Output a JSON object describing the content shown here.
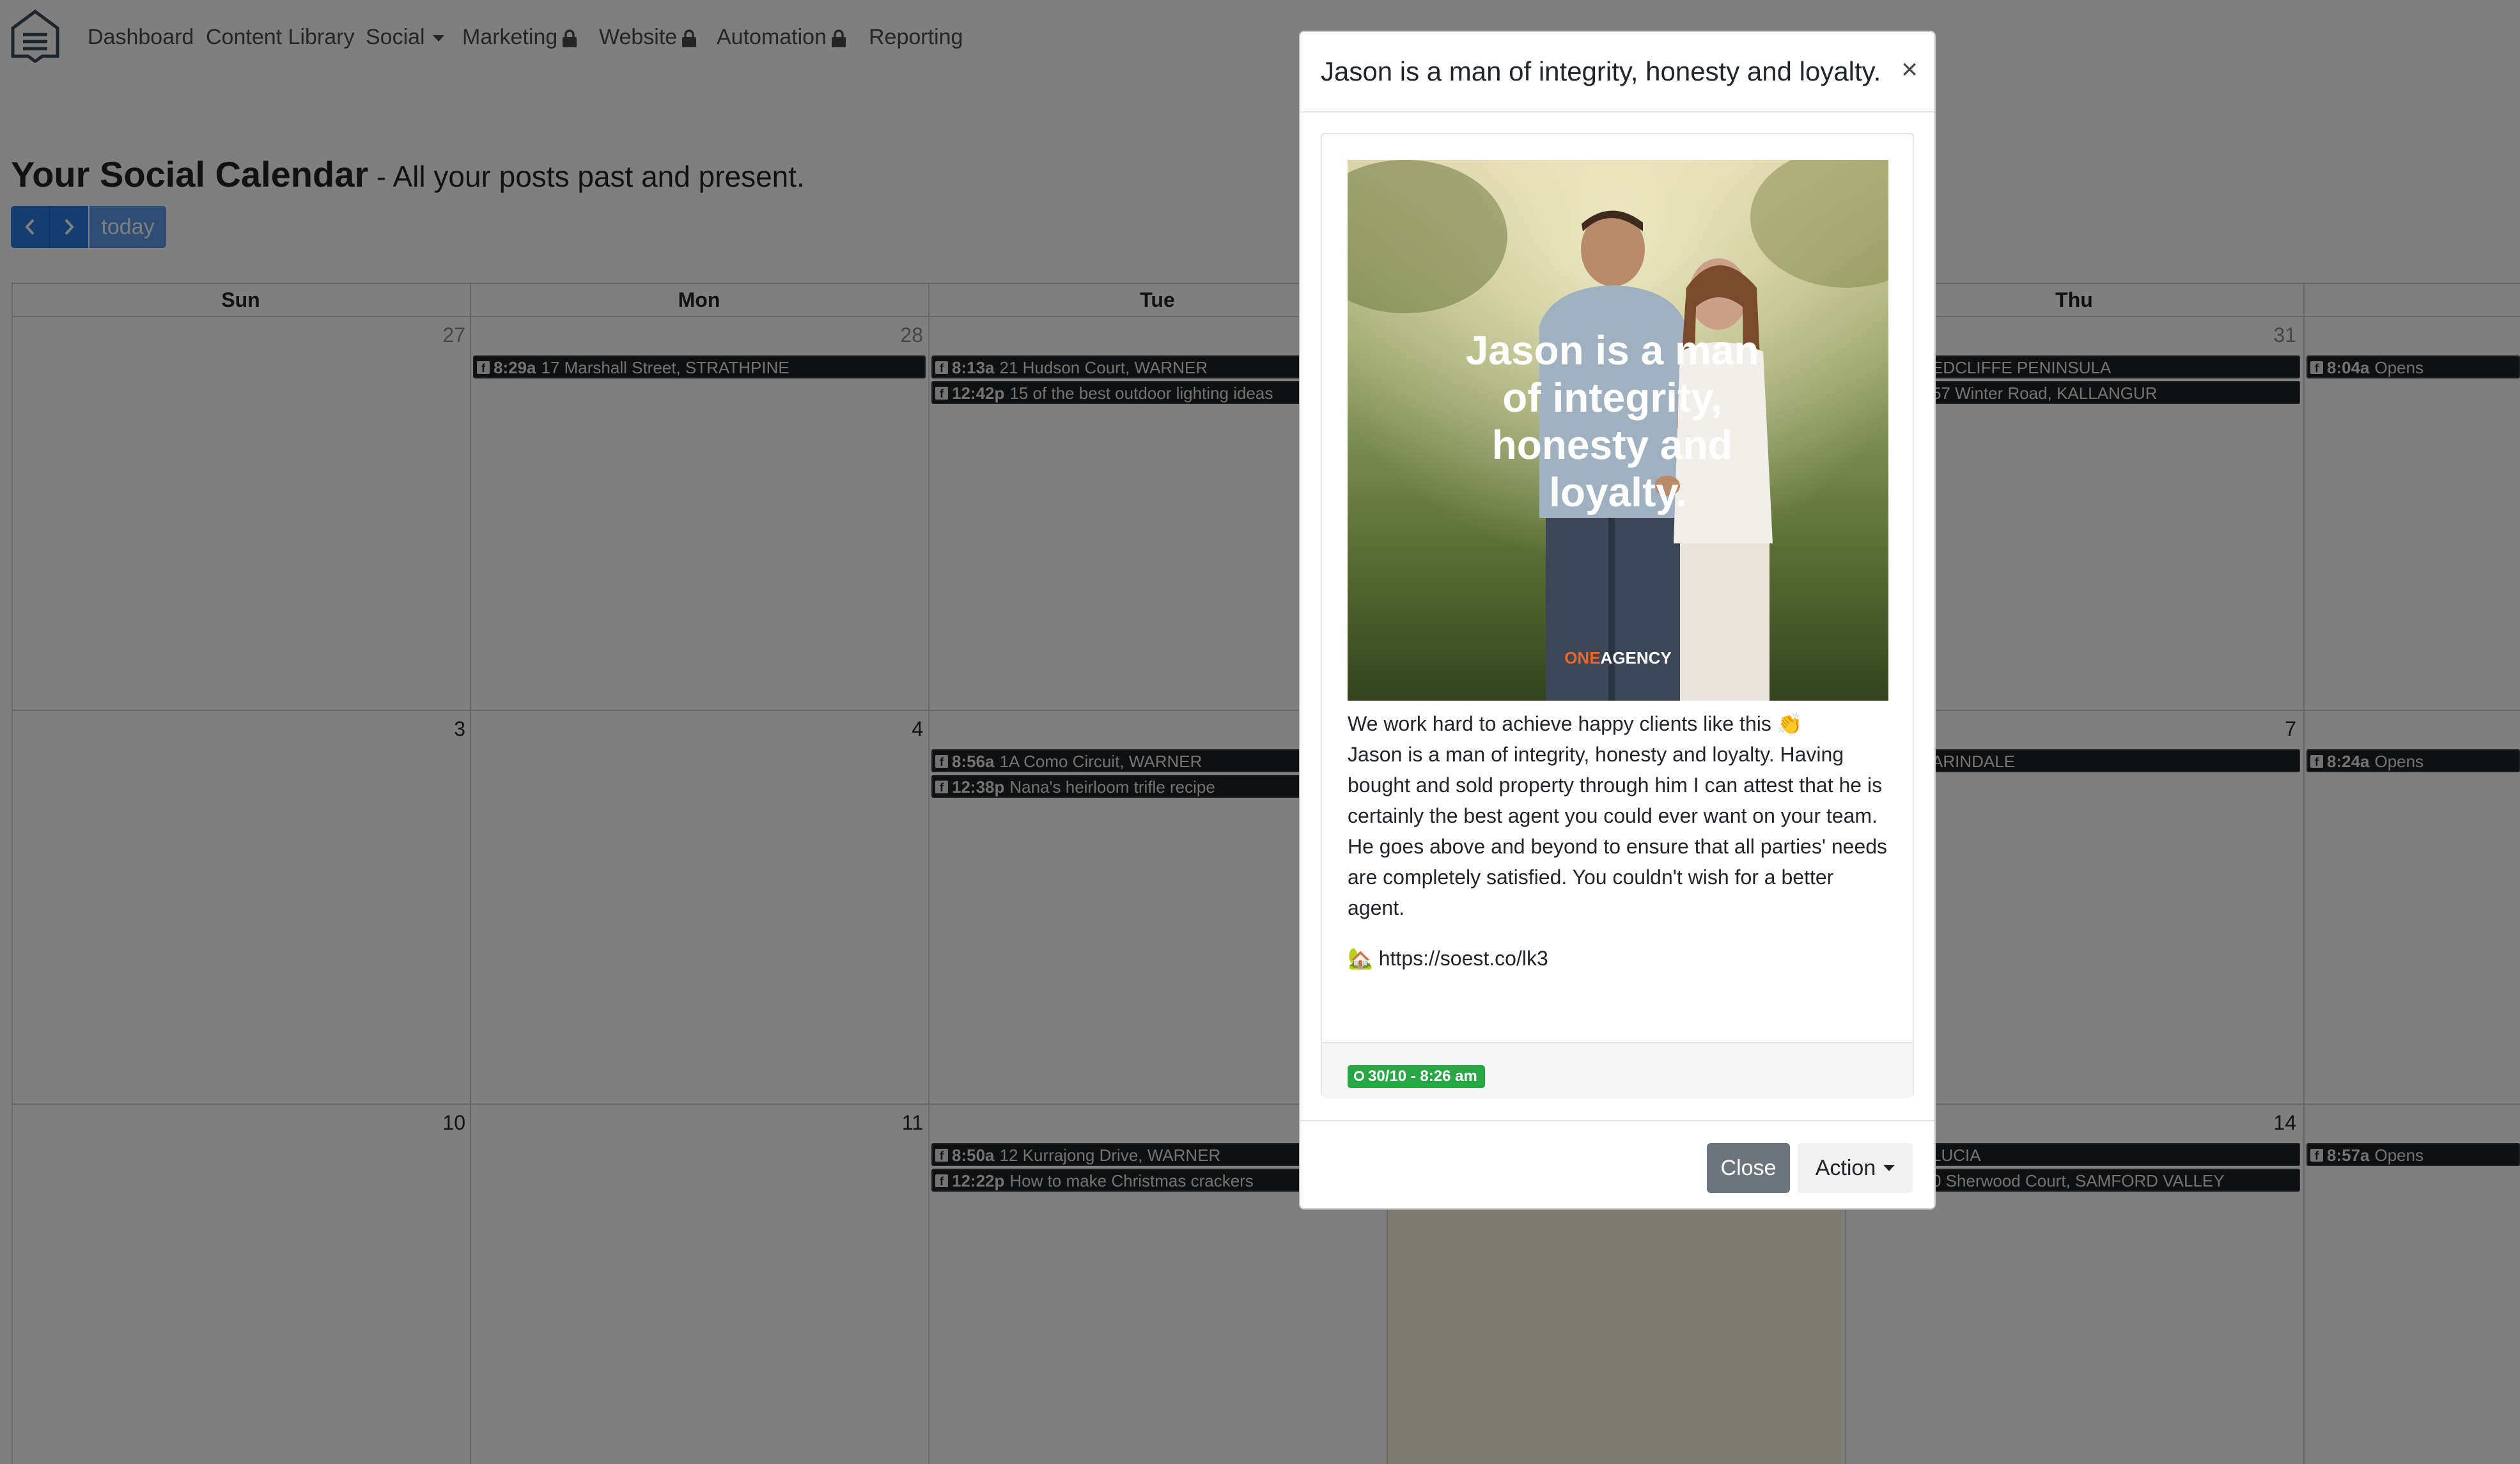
{
  "nav": {
    "items": [
      {
        "label": "Dashboard"
      },
      {
        "label": "Content Library"
      },
      {
        "label": "Social"
      },
      {
        "label": "Marketing"
      },
      {
        "label": "Website"
      },
      {
        "label": "Automation"
      },
      {
        "label": "Reporting"
      }
    ]
  },
  "header": {
    "title": "Your Social Calendar",
    "subtitle": " - All your posts past and present."
  },
  "calendar": {
    "today_label": "today",
    "days_of_week": [
      "Sun",
      "Mon",
      "Tue",
      "Thu"
    ],
    "day_numbers": {
      "w1_sun": "27",
      "w1_mon": "28",
      "w1_thu": "31",
      "w2_sun": "3",
      "w2_mon": "4",
      "w2_thu": "7",
      "w3_sun": "10",
      "w3_mon": "11",
      "w3_thu": "14"
    },
    "events": {
      "w1_mon_1": {
        "time": "8:29a",
        "title": "17 Marshall Street, STRATHPINE"
      },
      "w1_tue_1": {
        "time": "8:13a",
        "title": "21 Hudson Court, WARNER"
      },
      "w1_tue_2": {
        "time": "12:42p",
        "title": "15 of the best outdoor lighting ideas"
      },
      "w1_thu_1": {
        "title": "EDCLIFFE PENINSULA"
      },
      "w1_thu_2": {
        "title": "57 Winter Road, KALLANGUR"
      },
      "w1_sat_1": {
        "time": "8:04a",
        "title": "Opens"
      },
      "w2_tue_1": {
        "time": "8:56a",
        "title": "1A Como Circuit, WARNER"
      },
      "w2_tue_2": {
        "time": "12:38p",
        "title": "Nana's heirloom trifle recipe"
      },
      "w2_thu_1": {
        "title": "ARINDALE"
      },
      "w2_sat_1": {
        "time": "8:24a",
        "title": "Opens"
      },
      "w3_tue_1": {
        "time": "8:50a",
        "title": "12 Kurrajong Drive, WARNER"
      },
      "w3_tue_2": {
        "time": "12:22p",
        "title": "How to make Christmas crackers"
      },
      "w3_thu_1": {
        "title": "LUCIA"
      },
      "w3_thu_2": {
        "title": "0 Sherwood Court, SAMFORD VALLEY"
      },
      "w3_sat_1": {
        "time": "8:57a",
        "title": "Opens"
      }
    }
  },
  "modal": {
    "title": "Jason is a man of integrity, honesty and loyalty.",
    "close_x": "×",
    "image_overlay_text": "Jason is a man of integrity, honesty and loyalty.",
    "image_logo": "ONEAGENCY",
    "body_line1": "We work hard to achieve happy clients like this 👏",
    "body_para": "Jason is a man of integrity, honesty and loyalty. Having bought and sold property through him I can attest that he is certainly the best agent you could ever want on your team. He goes above and beyond to ensure that all parties' needs are completely satisfied. You couldn't wish for a better agent.",
    "link_emoji": "🏡",
    "link": "https://soest.co/lk3",
    "schedule_badge": "30/10 - 8:26 am",
    "close_button": "Close",
    "action_button": "Action"
  },
  "colors": {
    "accent": "#2c7be5",
    "event_bg": "#1f2022",
    "today_bg": "#fcf8e3",
    "badge_green": "#28a745",
    "close_btn": "#6c757d"
  }
}
